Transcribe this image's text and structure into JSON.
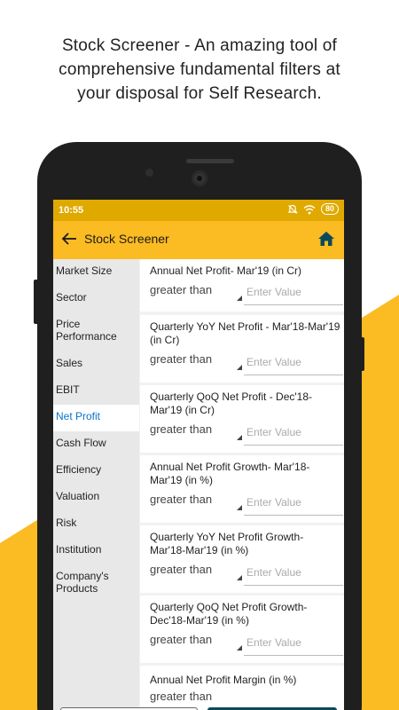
{
  "headline": {
    "line1": "Stock Screener - An amazing tool of",
    "line2": "comprehensive fundamental filters at",
    "line3": "your disposal for Self Research."
  },
  "status_bar": {
    "time": "10:55",
    "battery": "80"
  },
  "app_bar": {
    "title": "Stock Screener",
    "back_icon": "arrow-left-icon",
    "home_icon": "home-icon"
  },
  "colors": {
    "accent": "#fbbb22",
    "status": "#e0a900",
    "active": "#0b74c8"
  },
  "sidebar": {
    "items": [
      {
        "label": "Market Size",
        "active": false
      },
      {
        "label": "Sector",
        "active": false
      },
      {
        "label": "Price Performance",
        "active": false
      },
      {
        "label": "Sales",
        "active": false
      },
      {
        "label": "EBIT",
        "active": false
      },
      {
        "label": "Net Profit",
        "active": true
      },
      {
        "label": "Cash Flow",
        "active": false
      },
      {
        "label": "Efficiency",
        "active": false
      },
      {
        "label": "Valuation",
        "active": false
      },
      {
        "label": "Risk",
        "active": false
      },
      {
        "label": "Institution",
        "active": false
      },
      {
        "label": "Company's Products",
        "active": false
      }
    ]
  },
  "filters": [
    {
      "title": "Annual Net Profit- Mar'19 (in Cr)",
      "operator": "greater than",
      "placeholder": "Enter Value"
    },
    {
      "title": "Quarterly YoY Net Profit - Mar'18-Mar'19 (in Cr)",
      "operator": "greater than",
      "placeholder": "Enter Value"
    },
    {
      "title": "Quarterly QoQ Net Profit - Dec'18-Mar'19 (in Cr)",
      "operator": "greater than",
      "placeholder": "Enter Value"
    },
    {
      "title": "Annual Net Profit Growth- Mar'18-Mar'19 (in %)",
      "operator": "greater than",
      "placeholder": "Enter Value"
    },
    {
      "title": "Quarterly YoY Net Profit Growth- Mar'18-Mar'19 (in %)",
      "operator": "greater than",
      "placeholder": "Enter Value"
    },
    {
      "title": "Quarterly QoQ Net Profit Growth- Dec'18-Mar'19 (in %)",
      "operator": "greater than",
      "placeholder": "Enter Value"
    },
    {
      "title": "Annual Net Profit Margin (in %)",
      "operator": "greater than",
      "placeholder": ""
    }
  ]
}
